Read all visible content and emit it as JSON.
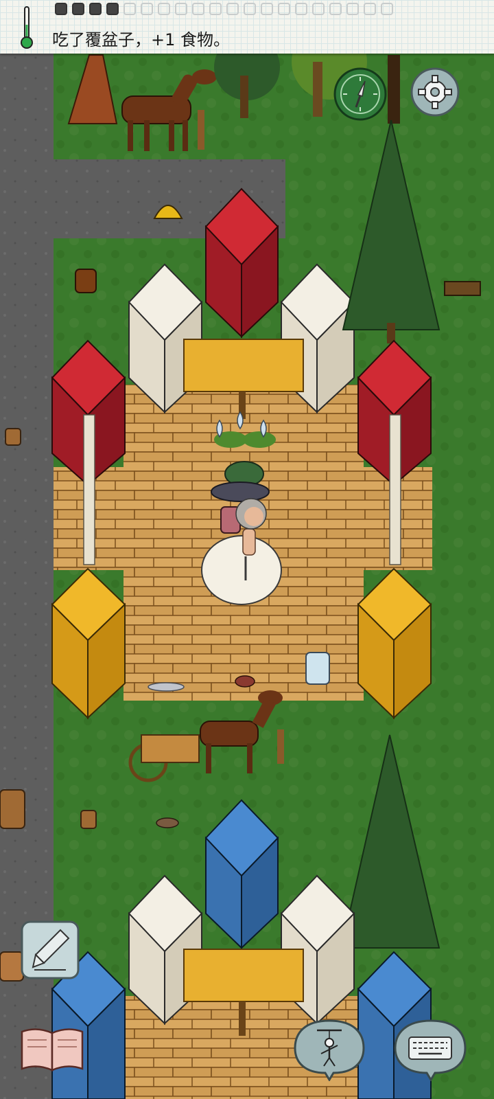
{
  "status": {
    "message": "吃了覆盆子，+1 食物。",
    "food_pips": [
      true,
      true,
      true,
      true,
      false,
      false,
      false,
      false,
      false,
      false,
      false,
      false,
      false,
      false,
      false,
      false,
      false,
      false,
      false,
      false
    ]
  },
  "colors": {
    "grass": "#3a7a2c",
    "road": "#5e5e5e",
    "floor": "#d9a860",
    "red_block": "#b3202a",
    "white_block": "#eae4d6",
    "yellow_block": "#e5a720",
    "blue_block": "#3f7bbf",
    "pine": "#2d5a2a",
    "ui_button": "#9fb6b8"
  },
  "icons": {
    "thermometer": "thermometer-icon",
    "compass": "compass-icon",
    "settings": "gear-icon",
    "pencil": "pencil-icon",
    "book": "book-icon",
    "puppet": "puppet-icon",
    "keyboard": "keyboard-icon"
  }
}
